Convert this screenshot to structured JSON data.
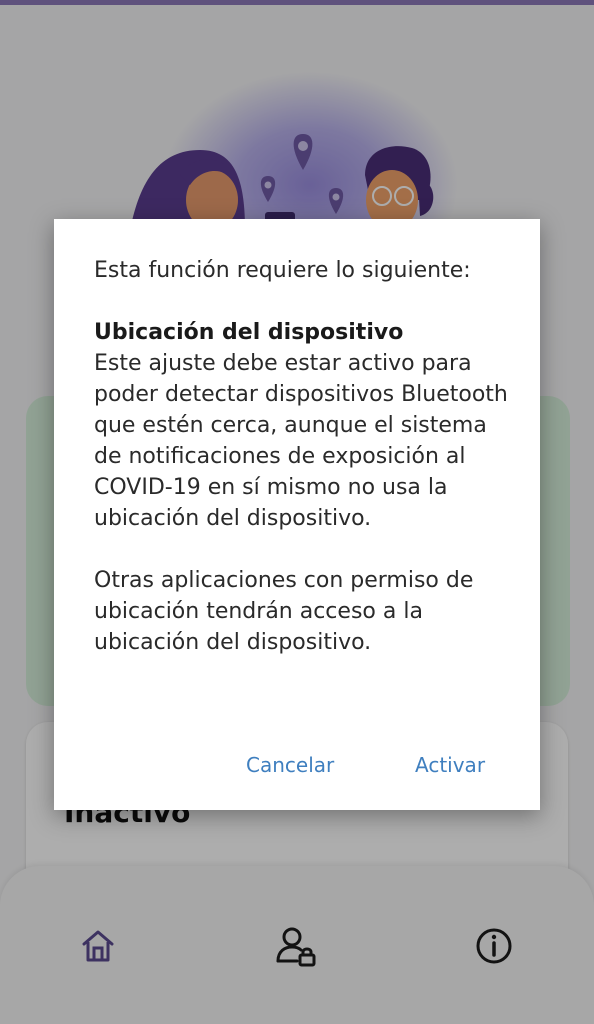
{
  "app": {
    "accent_color": "#8d79b9",
    "card_green_color": "#d6efdb",
    "link_color": "#3f7fbf"
  },
  "status_card": {
    "title": "Inactivo"
  },
  "bottom_nav": {
    "items": [
      {
        "icon": "home-icon"
      },
      {
        "icon": "user-lock-icon"
      },
      {
        "icon": "info-icon"
      }
    ]
  },
  "dialog": {
    "intro": "Esta función requiere lo siguiente:",
    "heading": "Ubicación del dispositivo",
    "description": "Este ajuste debe estar activo para poder detectar dispositivos Bluetooth que estén cerca, aunque el sistema de notificaciones de exposición al COVID-19 en sí mismo no usa la ubicación del dispositivo.",
    "note": "Otras aplicaciones con permiso de ubicación tendrán acceso a la ubicación del dispositivo.",
    "cancel_label": "Cancelar",
    "activate_label": "Activar"
  }
}
